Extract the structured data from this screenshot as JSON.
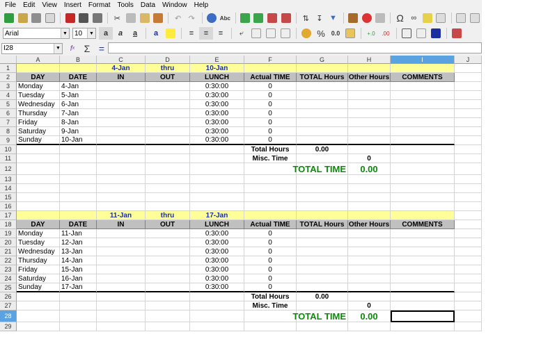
{
  "menu": [
    "File",
    "Edit",
    "View",
    "Insert",
    "Format",
    "Tools",
    "Data",
    "Window",
    "Help"
  ],
  "font": {
    "name": "Arial",
    "size": "10"
  },
  "namebox": "I28",
  "formula_icons": [
    "function-wizard-icon",
    "sum-icon",
    "equals-icon"
  ],
  "columns": [
    "A",
    "B",
    "C",
    "D",
    "E",
    "F",
    "G",
    "H",
    "I",
    "J"
  ],
  "selected_col": "I",
  "selected_row": 28,
  "block1": {
    "start_label": "4-Jan",
    "thru_label": "thru",
    "end_label": "10-Jan",
    "headers": [
      "DAY",
      "DATE",
      "IN",
      "OUT",
      "LUNCH",
      "Actual TIME",
      "TOTAL Hours",
      "Other Hours",
      "COMMENTS"
    ],
    "rows": [
      {
        "day": "Monday",
        "date": "4-Jan",
        "lunch": "0:30:00",
        "actual": "0"
      },
      {
        "day": "Tuesday",
        "date": "5-Jan",
        "lunch": "0:30:00",
        "actual": "0"
      },
      {
        "day": "Wednesday",
        "date": "6-Jan",
        "lunch": "0:30:00",
        "actual": "0"
      },
      {
        "day": "Thursday",
        "date": "7-Jan",
        "lunch": "0:30:00",
        "actual": "0"
      },
      {
        "day": "Friday",
        "date": "8-Jan",
        "lunch": "0:30:00",
        "actual": "0"
      },
      {
        "day": "Saturday",
        "date": "9-Jan",
        "lunch": "0:30:00",
        "actual": "0"
      },
      {
        "day": "Sunday",
        "date": "10-Jan",
        "lunch": "0:30:00",
        "actual": "0"
      }
    ],
    "total_hours_label": "Total Hours",
    "total_hours_value": "0.00",
    "misc_label": "Misc. Time",
    "misc_value": "0",
    "total_time_label": "TOTAL TIME",
    "total_time_value": "0.00"
  },
  "block2": {
    "start_label": "11-Jan",
    "thru_label": "thru",
    "end_label": "17-Jan",
    "headers": [
      "DAY",
      "DATE",
      "IN",
      "OUT",
      "LUNCH",
      "Actual TIME",
      "TOTAL Hours",
      "Other Hours",
      "COMMENTS"
    ],
    "rows": [
      {
        "day": "Monday",
        "date": "11-Jan",
        "lunch": "0:30:00",
        "actual": "0"
      },
      {
        "day": "Tuesday",
        "date": "12-Jan",
        "lunch": "0:30:00",
        "actual": "0"
      },
      {
        "day": "Wednesday",
        "date": "13-Jan",
        "lunch": "0:30:00",
        "actual": "0"
      },
      {
        "day": "Thursday",
        "date": "14-Jan",
        "lunch": "0:30:00",
        "actual": "0"
      },
      {
        "day": "Friday",
        "date": "15-Jan",
        "lunch": "0:30:00",
        "actual": "0"
      },
      {
        "day": "Saturday",
        "date": "16-Jan",
        "lunch": "0:30:00",
        "actual": "0"
      },
      {
        "day": "Sunday",
        "date": "17-Jan",
        "lunch": "0:30:00",
        "actual": "0"
      }
    ],
    "total_hours_label": "Total Hours",
    "total_hours_value": "0.00",
    "misc_label": "Misc. Time",
    "misc_value": "0",
    "total_time_label": "TOTAL TIME",
    "total_time_value": "0.00"
  },
  "colors": {
    "header_gray": "#c0c0c0",
    "title_yellow": "#ffff99",
    "title_blue": "#1a2fa0",
    "total_green": "#0a8a0a",
    "selection": "#5ba3e0"
  }
}
